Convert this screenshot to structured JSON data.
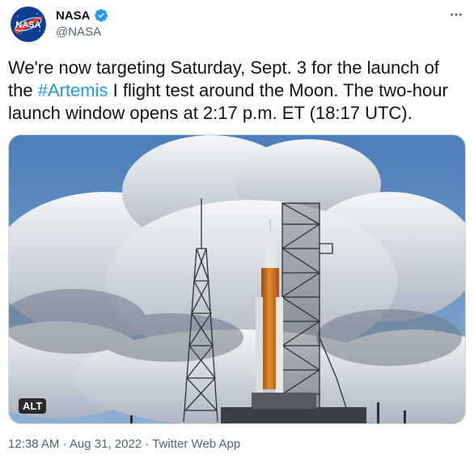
{
  "author": {
    "avatar_text": "NASA",
    "display_name": "NASA",
    "handle": "@NASA",
    "verified_icon": "verified-badge-icon"
  },
  "tweet": {
    "text_before": "We're now targeting Saturday, Sept. 3 for the launch of the ",
    "hashtag": "#Artemis",
    "text_after": " I flight test around the Moon. The two-hour launch window opens at 2:17 p.m. ET (18:17 UTC)."
  },
  "media": {
    "alt_label": "ALT"
  },
  "meta": {
    "time": "12:38 AM",
    "sep1": " · ",
    "date": "Aug 31, 2022",
    "sep2": " · ",
    "source": "Twitter Web App"
  },
  "colors": {
    "accent": "#1d9bf0",
    "text": "#0f1419",
    "secondary": "#536471"
  }
}
